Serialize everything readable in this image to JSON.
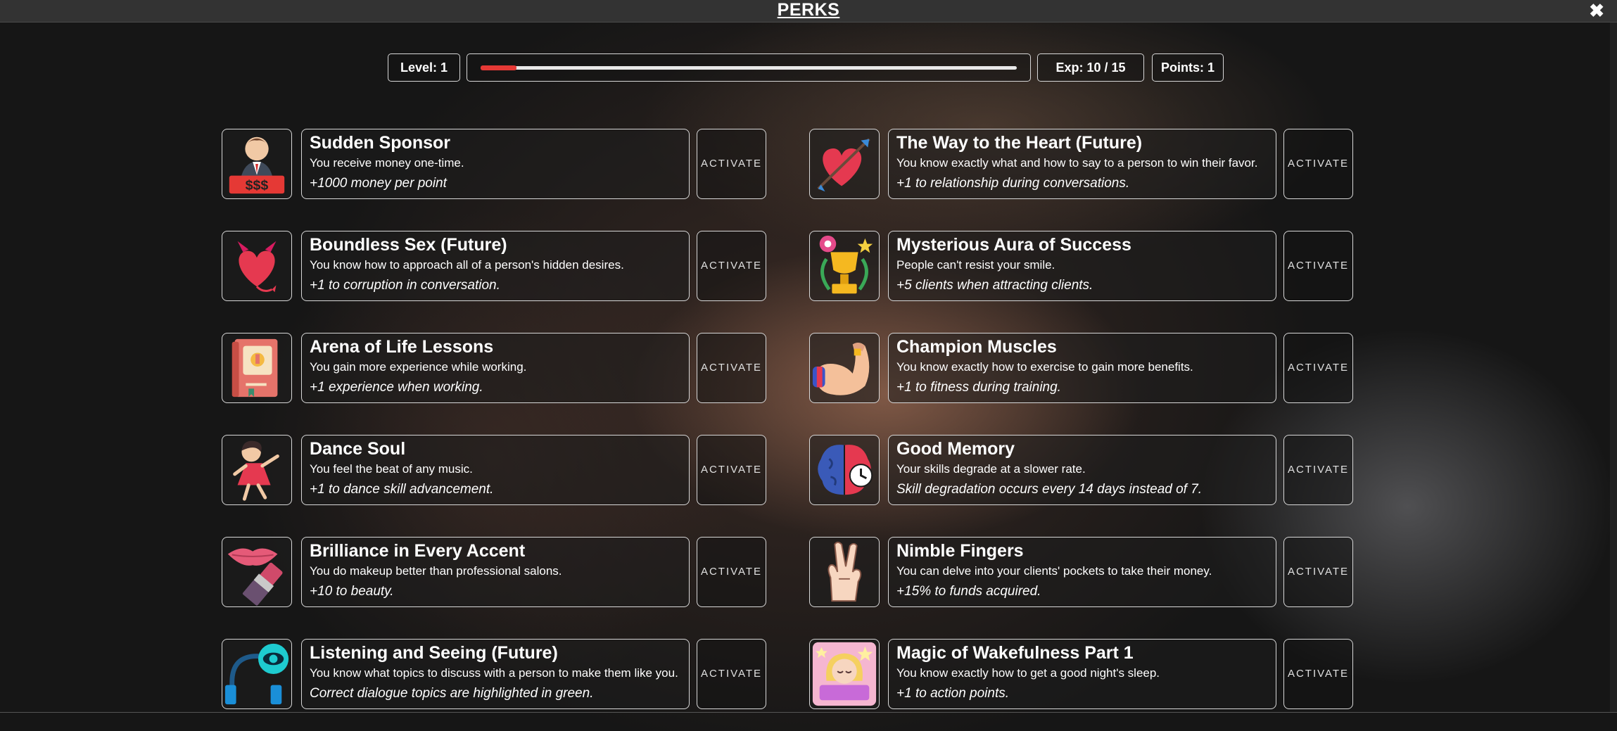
{
  "header": {
    "title": "PERKS",
    "close_icon": "close-icon"
  },
  "stats": {
    "level": "Level: 1",
    "exp": "Exp: 10 / 15",
    "points": "Points: 1",
    "progress_fraction": 0.0667,
    "progress_color": "#e53935"
  },
  "activate_label": "ACTIVATE",
  "perks_left": [
    {
      "title": "Sudden Sponsor",
      "desc": "You receive money one-time.",
      "effect": "+1000 money per point",
      "icon": "sponsor-money-icon"
    },
    {
      "title": "Boundless Sex (Future)",
      "desc": "You know how to approach all of a person's hidden desires.",
      "effect": "+1 to corruption in conversation.",
      "icon": "devil-heart-icon"
    },
    {
      "title": "Arena of Life Lessons",
      "desc": "You gain more experience while working.",
      "effect": "+1 experience when working.",
      "icon": "book-icon"
    },
    {
      "title": "Dance Soul",
      "desc": "You feel the beat of any music.",
      "effect": "+1 to dance skill advancement.",
      "icon": "dancer-icon"
    },
    {
      "title": "Brilliance in Every Accent",
      "desc": "You do makeup better than professional salons.",
      "effect": "+10 to beauty.",
      "icon": "lipstick-icon"
    },
    {
      "title": "Listening and Seeing (Future)",
      "desc": "You know what topics to discuss with a person to make them like you.",
      "effect": "Correct dialogue topics are highlighted in green.",
      "icon": "headphones-eye-icon"
    }
  ],
  "perks_right": [
    {
      "title": "The Way to the Heart (Future)",
      "desc": "You know exactly what and how to say to a person to win their favor.",
      "effect": "+1 to relationship during conversations.",
      "icon": "heart-arrow-icon"
    },
    {
      "title": "Mysterious Aura of Success",
      "desc": "People can't resist your smile.",
      "effect": "+5 clients when attracting clients.",
      "icon": "trophy-icon"
    },
    {
      "title": "Champion Muscles",
      "desc": "You know exactly how to exercise to gain more benefits.",
      "effect": "+1 to fitness during training.",
      "icon": "flexed-arm-icon"
    },
    {
      "title": "Good Memory",
      "desc": "Your skills degrade at a slower rate.",
      "effect": "Skill degradation occurs every 14 days instead of 7.",
      "icon": "brain-clock-icon"
    },
    {
      "title": "Nimble Fingers",
      "desc": "You can delve into your clients' pockets to take their money.",
      "effect": "+15% to funds acquired.",
      "icon": "hand-gesture-icon"
    },
    {
      "title": "Magic of Wakefulness Part 1",
      "desc": "You know exactly how to get a good night's sleep.",
      "effect": "+1 to action points.",
      "icon": "sleeping-girl-icon"
    }
  ]
}
